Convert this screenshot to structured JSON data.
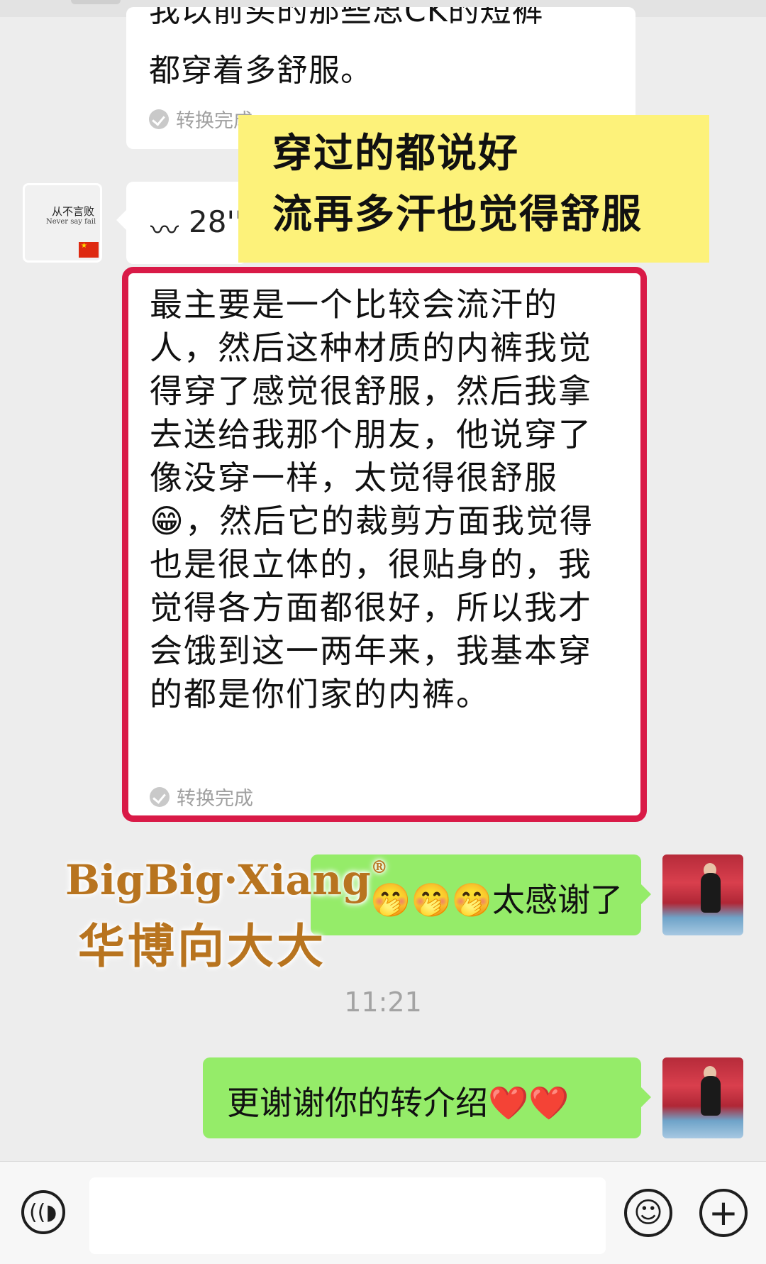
{
  "messages": {
    "partial": {
      "line1": "我以前买的那些思CK的短裤",
      "line2": "都穿着多舒服。",
      "status": "转换完成"
    },
    "voice": {
      "duration": "28''"
    },
    "overlay_caption": {
      "line1": "穿过的都说好",
      "line2": "流再多汗也觉得舒服"
    },
    "transcript": {
      "text": "最主要是一个比较会流汗的人，然后这种材质的内裤我觉得穿了感觉很舒服，然后我拿去送给我那个朋友，他说穿了像没穿一样，太觉得很舒服😁，然后它的裁剪方面我觉得也是很立体的，很贴身的，我觉得各方面都很好，所以我才会饿到这一两年来，我基本穿的都是你们家的内裤。",
      "status": "转换完成"
    },
    "reply1": "🤭🤭🤭太感谢了",
    "timestamp": "11:21",
    "reply2": "更谢谢你的转介绍❤️❤️"
  },
  "contact_avatar": {
    "text_cn": "从不言败",
    "text_en": "Never say fail"
  },
  "watermark": {
    "line1": "BigBig·Xiang",
    "mark": "®",
    "line2": "华博向大大"
  },
  "colors": {
    "outgoing_bubble": "#95ec69",
    "highlight_border": "#d91a47",
    "caption_bg": "#fdf27a"
  }
}
